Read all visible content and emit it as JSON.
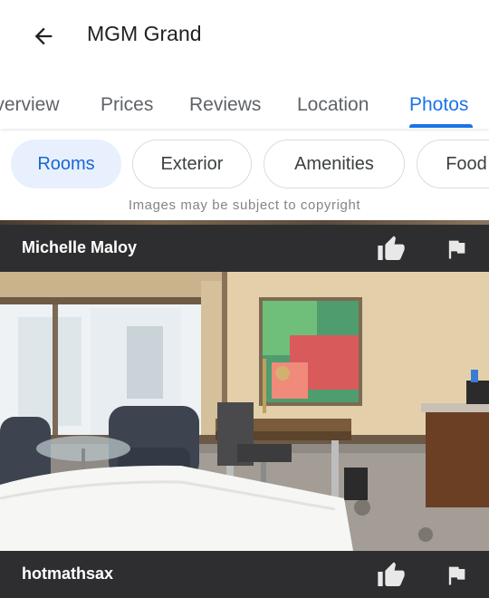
{
  "header": {
    "title": "MGM Grand",
    "back_icon": "arrow-back-icon"
  },
  "tabs": [
    {
      "label": "Overview"
    },
    {
      "label": "Prices"
    },
    {
      "label": "Reviews"
    },
    {
      "label": "Location"
    },
    {
      "label": "Photos",
      "active": true
    }
  ],
  "chips": [
    {
      "label": "Rooms",
      "active": true
    },
    {
      "label": "Exterior"
    },
    {
      "label": "Amenities"
    },
    {
      "label": "Food"
    }
  ],
  "copyright_notice": "Images may be subject to copyright",
  "photos": [
    {
      "author": "Michelle Maloy",
      "like_icon": "thumb-up-icon",
      "flag_icon": "flag-icon"
    },
    {
      "author": "hotmathsax",
      "like_icon": "thumb-up-icon",
      "flag_icon": "flag-icon"
    }
  ],
  "colors": {
    "accent": "#1a73e8",
    "chip_active_bg": "#e8f0fe",
    "bar_bg": "#2e2e30"
  }
}
